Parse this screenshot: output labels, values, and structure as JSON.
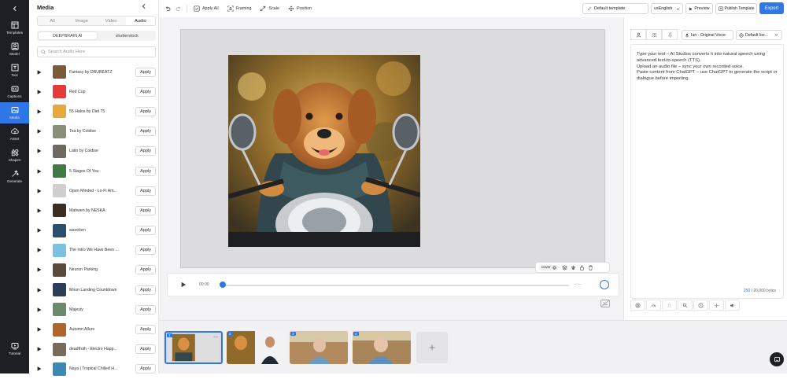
{
  "rail": {
    "items": [
      {
        "label": "Templates",
        "icon": "templates-icon"
      },
      {
        "label": "Model",
        "icon": "model-icon"
      },
      {
        "label": "Text",
        "icon": "text-icon"
      },
      {
        "label": "Captions",
        "icon": "captions-icon"
      },
      {
        "label": "Media",
        "icon": "media-icon",
        "active": true
      },
      {
        "label": "Asset",
        "icon": "asset-icon"
      },
      {
        "label": "Shapes",
        "icon": "shapes-icon"
      },
      {
        "label": "Generate",
        "icon": "generate-icon"
      }
    ],
    "tutorial_label": "Tutorial"
  },
  "media": {
    "title": "Media",
    "tabs": [
      "All",
      "Image",
      "Video",
      "Audio"
    ],
    "active_tab": "Audio",
    "sources": [
      "DEEPBRAIN AI",
      "shutterstock"
    ],
    "active_source": "DEEPBRAIN AI",
    "search_placeholder": "Search Audio Here",
    "apply_label": "Apply",
    "tracks": [
      {
        "name": "Fantasy by DRUBEATZ",
        "color": "#7a5b3a"
      },
      {
        "name": "Red Cup",
        "color": "#e33a3a"
      },
      {
        "name": "55 Halos by Diet 75",
        "color": "#e8a93a"
      },
      {
        "name": "Tea by Coldise",
        "color": "#8a8f7a"
      },
      {
        "name": "Latin by Coldise",
        "color": "#6e6a62"
      },
      {
        "name": "5 Stages Of You",
        "color": "#3f7a44"
      },
      {
        "name": "Open Minded - Lo-Fi Am...",
        "color": "#cfcfcf"
      },
      {
        "name": "Mahwen by NESKA",
        "color": "#3a2d22"
      },
      {
        "name": "wavelorn",
        "color": "#2b4e6a"
      },
      {
        "name": "The Intro We Have Been ...",
        "color": "#7cc2e0"
      },
      {
        "name": "Neuron Parking",
        "color": "#5a4a3c"
      },
      {
        "name": "Moon Landing Countdown",
        "color": "#2e3d55"
      },
      {
        "name": "Majesty",
        "color": "#6a8a6a"
      },
      {
        "name": "Autumn Allure",
        "color": "#b0662a"
      },
      {
        "name": "deadfroth - Electro Happ...",
        "color": "#7a6a5a"
      },
      {
        "name": "Naya | Tropical Chilled H...",
        "color": "#3b8ab5"
      }
    ]
  },
  "toolbar": {
    "apply_all": "Apply All",
    "framing": "Framing",
    "scale": "Scale",
    "position": "Position",
    "template": "Default template",
    "language": "usEnglish",
    "preview": "Preview",
    "publish": "Publish Template",
    "export": "Export"
  },
  "canvas": {
    "cover_label": "cover"
  },
  "player": {
    "current_time": "00:00",
    "total_time": "--:--"
  },
  "script": {
    "voice": "Ian - Original Voice",
    "locale": "Default loc...",
    "lines": [
      "Type your text – AI Studios converts it into natural speech using advanced text-to-speech (TTS).",
      "Upload an audio file – sync your own recorded voice.",
      "Paste content from ChatGPT – use ChatGPT to generate the script or dialogue before importing."
    ],
    "char_count": "250",
    "char_limit": "/ 20,000 bytes"
  },
  "timeline": {
    "scenes": [
      "1",
      "2",
      "3",
      "4"
    ],
    "selected_scene": "1",
    "more_label": "..."
  },
  "colors": {
    "accent": "#2f76e6",
    "rail_bg": "#1e1f24"
  }
}
